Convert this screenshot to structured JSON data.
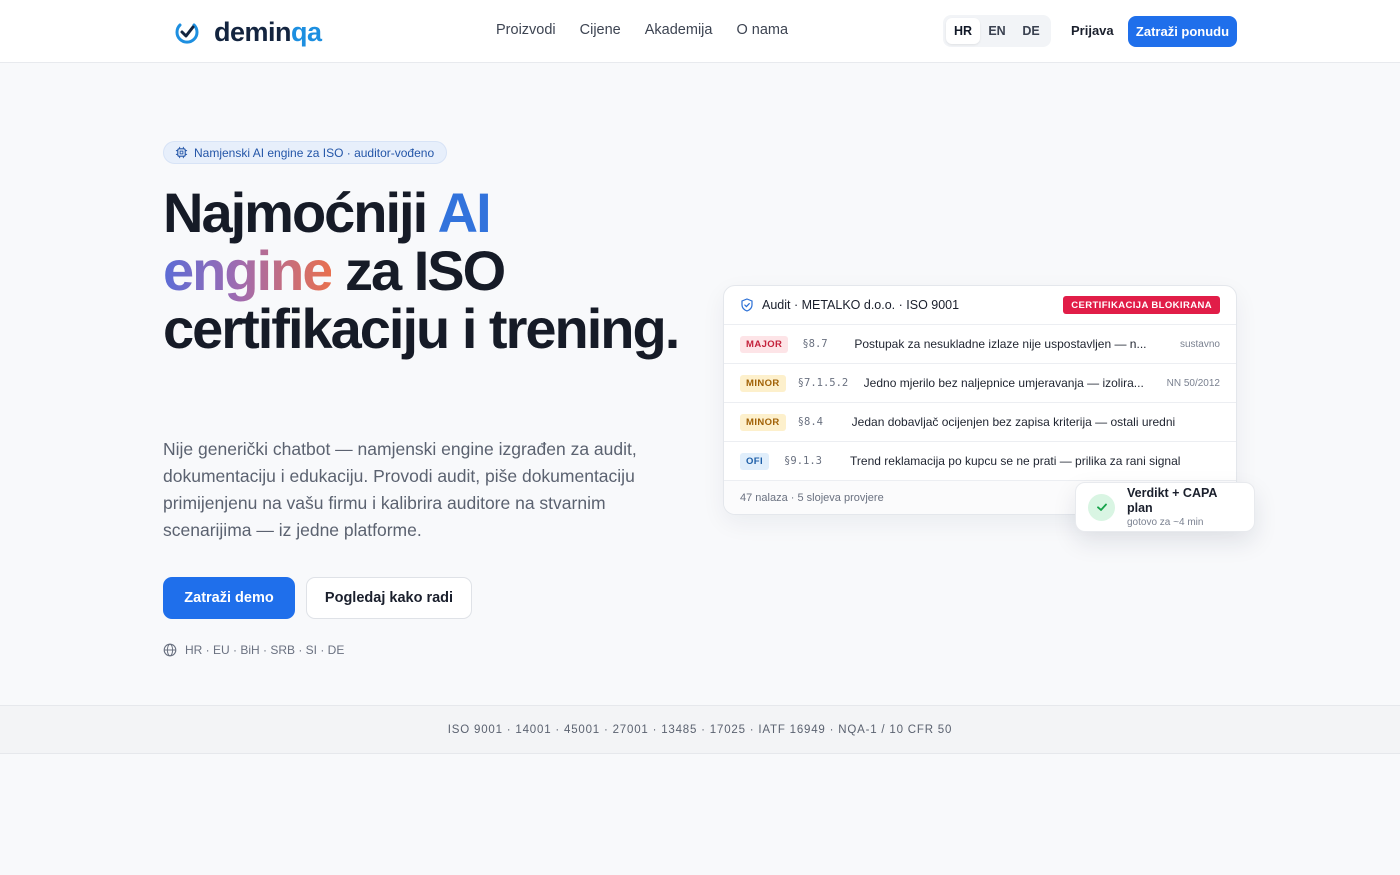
{
  "header": {
    "logo_text_main": "demin",
    "logo_text_accent": "qa",
    "nav": [
      {
        "label": "Proizvodi"
      },
      {
        "label": "Cijene"
      },
      {
        "label": "Akademija"
      },
      {
        "label": "O nama"
      }
    ],
    "languages": [
      {
        "code": "HR",
        "active": true
      },
      {
        "code": "EN",
        "active": false
      },
      {
        "code": "DE",
        "active": false
      }
    ],
    "login_label": "Prijava",
    "cta_label": "Zatraži ponudu"
  },
  "hero": {
    "badge": "Namjenski AI engine za ISO · auditor-vođeno",
    "title_part1": "Najmoćniji ",
    "title_ai": "AI",
    "title_engine": "engine",
    "title_part2": " za ISO certifikaciju i trening.",
    "description": "Nije generički chatbot — namjenski engine izgrađen za audit, dokumentaciju i edukaciju. Provodi audit, piše dokumentaciju primijenjenu na vašu firmu i kalibrira auditore na stvarnim scenarijima — iz jedne platforme.",
    "demo_button": "Zatraži demo",
    "how_button": "Pogledaj kako radi",
    "regions": "HR · EU · BiH · SRB · SI · DE"
  },
  "audit_card": {
    "title": "Audit · METALKO d.o.o. · ISO 9001",
    "status": "CERTIFIKACIJA BLOKIRANA",
    "rows": [
      {
        "severity": "MAJOR",
        "clause": "§8.7",
        "text": "Postupak za nesukladne izlaze nije uspostavljen — n...",
        "tag": "sustavno"
      },
      {
        "severity": "MINOR",
        "clause": "§7.1.5.2",
        "text": "Jedno mjerilo bez naljepnice umjeravanja — izolira...",
        "tag": "NN 50/2012"
      },
      {
        "severity": "MINOR",
        "clause": "§8.4",
        "text": "Jedan dobavljač ocijenjen bez zapisa kriterija — ostali uredni",
        "tag": ""
      },
      {
        "severity": "OFI",
        "clause": "§9.1.3",
        "text": "Trend reklamacija po kupcu se ne prati — prilika za rani signal",
        "tag": ""
      }
    ],
    "footer": "47 nalaza · 5 slojeva provjere"
  },
  "verdict": {
    "title": "Verdikt + CAPA plan",
    "subtitle": "gotovo za ~4 min"
  },
  "standards": "ISO 9001 · 14001 · 45001 · 27001 · 13485 · 17025 · IATF 16949 · NQA-1 / 10 CFR 50",
  "colors": {
    "accent": "#1f6feb",
    "ai_blue": "#3273dc",
    "blocked_red": "#e11d48",
    "major_text": "#c4223c",
    "minor_text": "#a16207",
    "ofi_text": "#1e5fa8"
  }
}
